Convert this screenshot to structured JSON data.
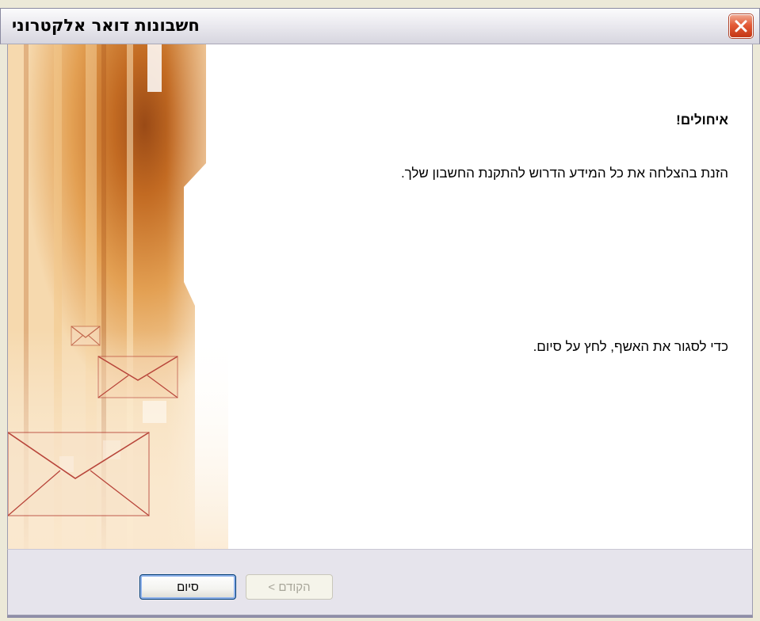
{
  "window": {
    "title": "חשבונות דואר אלקטרוני",
    "close_icon": "close-icon"
  },
  "main": {
    "heading": "איחולים!",
    "message": "הזנת בהצלחה את כל המידע הדרוש להתקנת החשבון שלך.",
    "instruction": "כדי לסגור את האשף, לחץ על סיום."
  },
  "footer": {
    "finish_label": "סיום",
    "back_label": "< הקודם"
  },
  "colors": {
    "close_button": "#e35a36",
    "art_accent": "#c86a1e",
    "envelope_stroke": "#b8453a"
  }
}
